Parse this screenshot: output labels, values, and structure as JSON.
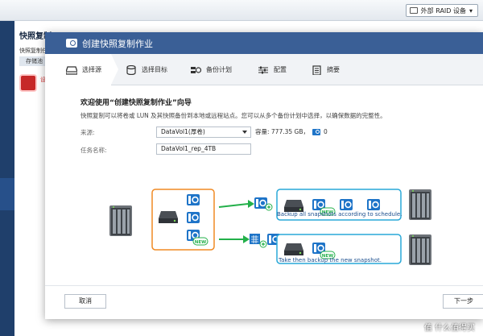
{
  "background": {
    "raid_button": "外部 RAID 设备",
    "page_title": "快照复制",
    "subtitle": "快照复制任",
    "tab": "存储池",
    "alert_text": "设"
  },
  "modal": {
    "title": "创建快照复制作业",
    "steps": [
      {
        "label": "选择源",
        "icon": "disk-icon"
      },
      {
        "label": "选择目标",
        "icon": "database-icon"
      },
      {
        "label": "备份计划",
        "icon": "schedule-icon"
      },
      {
        "label": "配置",
        "icon": "settings-icon"
      },
      {
        "label": "摘要",
        "icon": "clipboard-icon"
      }
    ],
    "welcome": "欢迎使用“创建快照复制作业”向导",
    "description": "快照复制可以将卷或 LUN 及其快照备份到本地或远程站点。您可以从多个备份计划中选择，以确保数据的完整性。",
    "source_label": "来源:",
    "source_value": "DataVol1(厚卷)",
    "capacity_label": "容量: 777.35 GB，",
    "snapshot_count": "0",
    "task_label": "任务名称:",
    "task_value": "DataVol1_rep_4TB",
    "diagram": {
      "caption_top": "Backup all snapshots according to schedule.",
      "caption_bottom": "Take then backup the new snapshot.",
      "new_badge": "NEW",
      "colors": {
        "orange": "#f08a24",
        "blue": "#29a8d8",
        "green": "#23b04a",
        "snap": "#1e74c8"
      }
    },
    "cancel_button": "取消",
    "next_button": "下一步"
  },
  "watermark": "值 什么值得买"
}
